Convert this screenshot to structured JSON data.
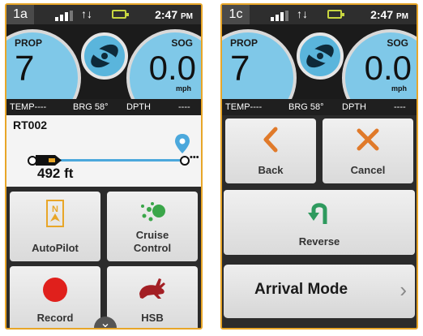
{
  "screens": {
    "a": {
      "id": "1a",
      "time": "2:47",
      "ampm": "PM",
      "prop_label": "PROP",
      "prop_value": "7",
      "sog_label": "SOG",
      "sog_value": "0.0",
      "sog_unit": "mph",
      "temp": "TEMP----",
      "brg": "BRG 58°",
      "dpth": "DPTH",
      "dpth_value": "----",
      "route_name": "RT002",
      "route_distance": "492 ft",
      "tiles": {
        "autopilot": "AutoPilot",
        "cruise_line1": "Cruise",
        "cruise_line2": "Control",
        "record": "Record",
        "hsb": "HSB"
      }
    },
    "c": {
      "id": "1c",
      "time": "2:47",
      "ampm": "PM",
      "prop_label": "PROP",
      "prop_value": "7",
      "sog_label": "SOG",
      "sog_value": "0.0",
      "sog_unit": "mph",
      "temp": "TEMP----",
      "brg": "BRG 58°",
      "dpth": "DPTH",
      "dpth_value": "----",
      "tiles": {
        "back": "Back",
        "cancel": "Cancel",
        "reverse": "Reverse",
        "arrival_mode": "Arrival Mode"
      }
    }
  },
  "colors": {
    "accent_orange": "#e8a628",
    "gauge_blue": "#7fc8e8",
    "route_blue": "#4ba8dc",
    "cruise_green": "#3aa649",
    "record_red": "#e0201c",
    "hsb_red": "#a31f24",
    "back_orange": "#e07a2a"
  },
  "icons": [
    "signal-bars-icon",
    "data-arrows-icon",
    "battery-icon",
    "propeller-icon",
    "route-pin-icon",
    "boat-icon",
    "autopilot-icon",
    "cruise-control-icon",
    "record-icon",
    "hsb-rabbit-icon",
    "chevron-down-icon",
    "back-chevron-icon",
    "cancel-x-icon",
    "reverse-u-turn-icon",
    "chevron-right-icon"
  ]
}
